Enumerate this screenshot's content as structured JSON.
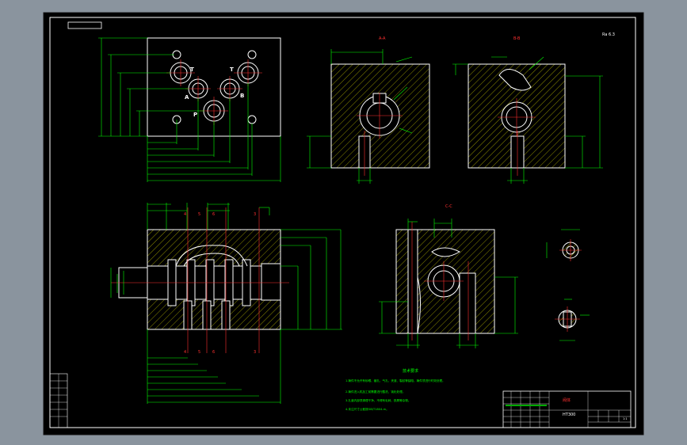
{
  "drawing": {
    "scale_note": "Ra 6.3",
    "section_labels": {
      "aa": "A-A",
      "bb": "B-B",
      "cc": "C-C"
    },
    "port_labels": {
      "t_left": "T",
      "t_right": "T",
      "a": "A",
      "b": "B",
      "p": "P"
    },
    "front_view_markers": [
      "4",
      "5",
      "6",
      "3"
    ],
    "bottom_markers": [
      "4",
      "5",
      "6",
      "3"
    ],
    "tech_requirements": {
      "title": "技术要求",
      "lines": [
        "1.铸件不允许有砂眼、缩孔、气孔、夹渣、裂纹等缺陷，铸件须进行时效处理。",
        "2.铸件进入机加工前需要进行酸洗、钝化处理。",
        "3.孔道内部须清理干净，不得有毛刺、铁屑等杂物。",
        "4.未注尺寸公差按GB/T1804-m。"
      ]
    },
    "title_block": {
      "part_name": "阀体",
      "material": "HT300",
      "sheet_info": "1:1"
    },
    "colors": {
      "background": "#000000",
      "outline": "#ffffff",
      "hatch": "#ffff00",
      "dimension": "#00ff00",
      "centerline": "#ff0000",
      "frame_outer": "#8a949e"
    }
  }
}
